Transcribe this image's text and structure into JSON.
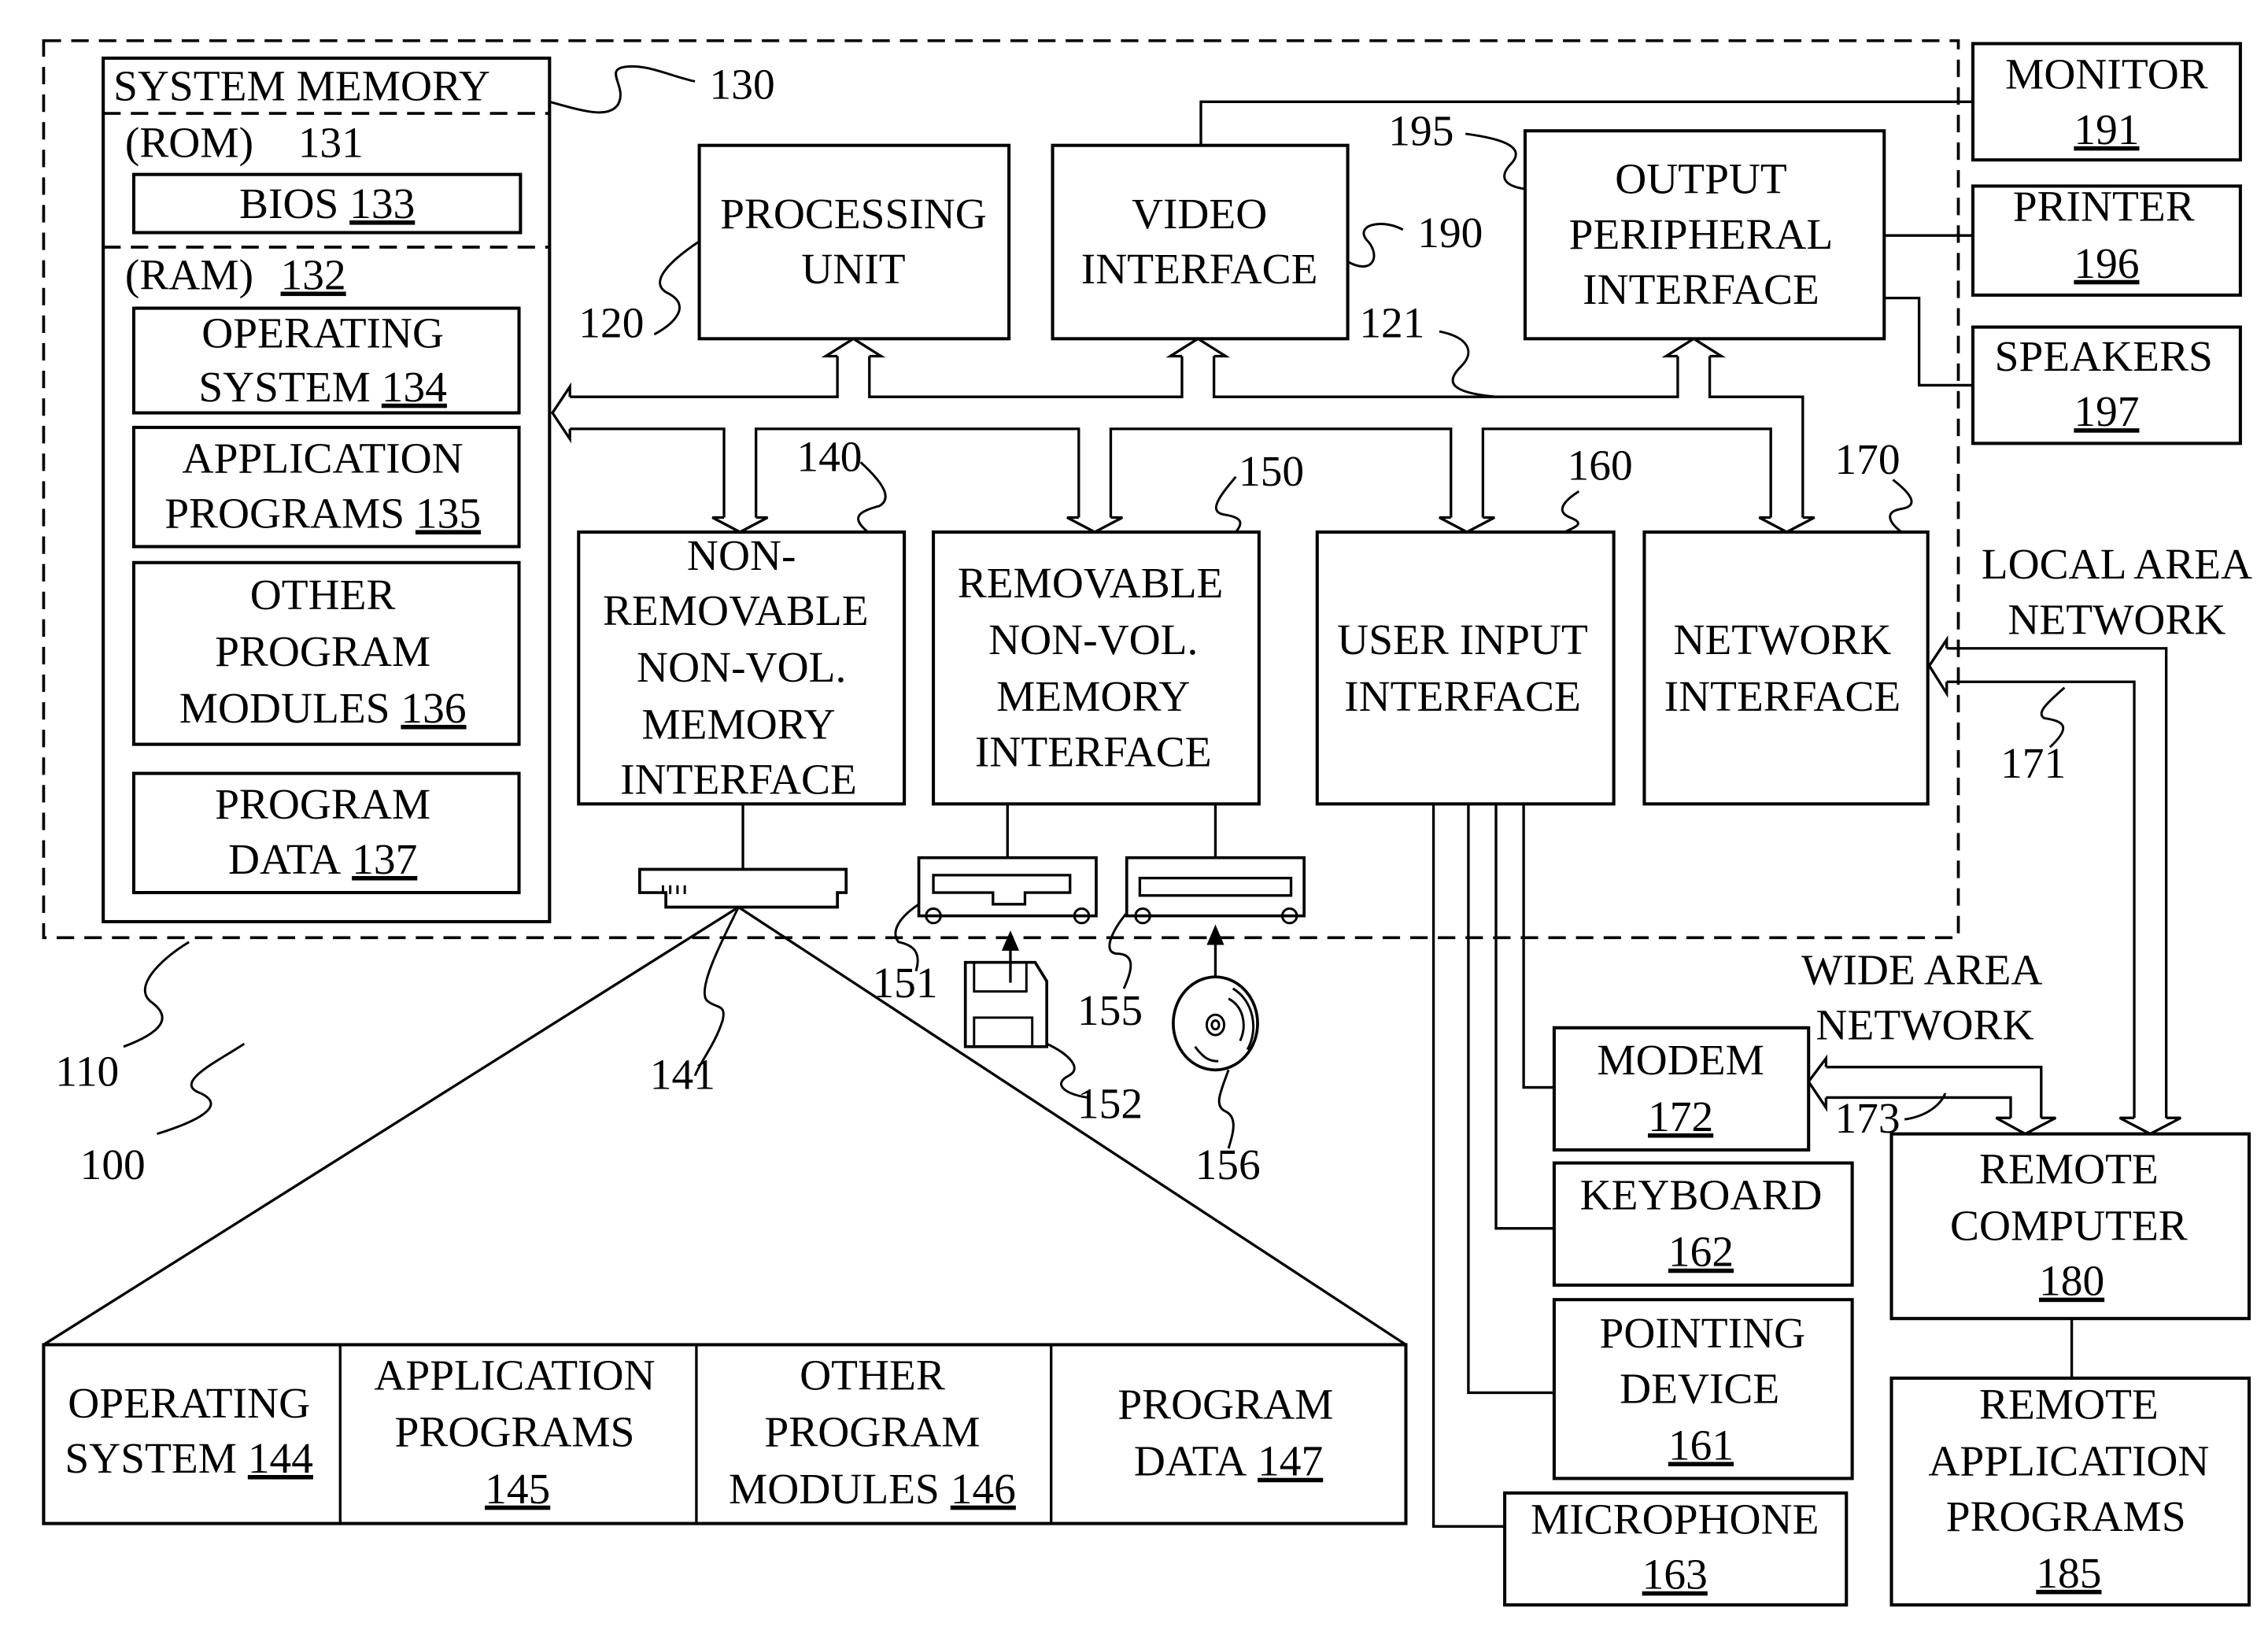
{
  "figure": {
    "reference_100": "100",
    "computer_110": "110",
    "system_bus_121": "121"
  },
  "system_memory": {
    "title": "SYSTEM MEMORY",
    "ref": "130",
    "rom_label": "(ROM)",
    "rom_ref": "131",
    "bios_label": "BIOS",
    "bios_ref": "133",
    "ram_label": "(RAM)",
    "ram_ref": "132",
    "items": [
      {
        "lines": [
          "OPERATING",
          "SYSTEM"
        ],
        "ref": "134"
      },
      {
        "lines": [
          "APPLICATION",
          "PROGRAMS"
        ],
        "ref": "135"
      },
      {
        "lines": [
          "OTHER",
          "PROGRAM",
          "MODULES"
        ],
        "ref": "136"
      },
      {
        "lines": [
          "PROGRAM",
          "DATA"
        ],
        "ref": "137"
      }
    ]
  },
  "processing_unit": {
    "lines": [
      "PROCESSING",
      "UNIT"
    ],
    "ref": "120"
  },
  "video_interface": {
    "lines": [
      "VIDEO",
      "INTERFACE"
    ],
    "ref": "190"
  },
  "output_peripheral": {
    "lines": [
      "OUTPUT",
      "PERIPHERAL",
      "INTERFACE"
    ],
    "ref": "195"
  },
  "monitor": {
    "label": "MONITOR",
    "ref": "191"
  },
  "printer": {
    "label": "PRINTER",
    "ref": "196"
  },
  "speakers": {
    "label": "SPEAKERS",
    "ref": "197"
  },
  "non_removable": {
    "lines": [
      "NON-",
      "REMOVABLE",
      "NON-VOL.",
      "MEMORY",
      "INTERFACE"
    ],
    "ref": "140"
  },
  "removable": {
    "lines": [
      "REMOVABLE",
      "NON-VOL.",
      "MEMORY",
      "INTERFACE"
    ],
    "ref": "150"
  },
  "user_input": {
    "lines": [
      "USER INPUT",
      "INTERFACE"
    ],
    "ref": "160"
  },
  "network_interface": {
    "lines": [
      "NETWORK",
      "INTERFACE"
    ],
    "ref": "170"
  },
  "devices": {
    "hard_disk_ref": "141",
    "floppy_drive_ref": "151",
    "floppy_disk_ref": "152",
    "optical_drive_ref": "155",
    "optical_disk_ref": "156"
  },
  "lan": {
    "lines": [
      "LOCAL AREA",
      "NETWORK"
    ],
    "ref": "171"
  },
  "wan": {
    "lines": [
      "WIDE AREA",
      "NETWORK"
    ],
    "ref": "173"
  },
  "modem": {
    "label": "MODEM",
    "ref": "172"
  },
  "keyboard": {
    "label": "KEYBOARD",
    "ref": "162"
  },
  "pointing_device": {
    "lines": [
      "POINTING",
      "DEVICE"
    ],
    "ref": "161"
  },
  "microphone": {
    "label": "MICROPHONE",
    "ref": "163"
  },
  "remote_computer": {
    "lines": [
      "REMOTE",
      "COMPUTER"
    ],
    "ref": "180"
  },
  "remote_apps": {
    "lines": [
      "REMOTE",
      "APPLICATION",
      "PROGRAMS"
    ],
    "ref": "185"
  },
  "disk_contents": [
    {
      "lines": [
        "OPERATING",
        "SYSTEM"
      ],
      "ref": "144"
    },
    {
      "lines": [
        "APPLICATION",
        "PROGRAMS"
      ],
      "ref": "145"
    },
    {
      "lines": [
        "OTHER",
        "PROGRAM",
        "MODULES"
      ],
      "ref": "146"
    },
    {
      "lines": [
        "PROGRAM",
        "DATA"
      ],
      "ref": "147"
    }
  ]
}
